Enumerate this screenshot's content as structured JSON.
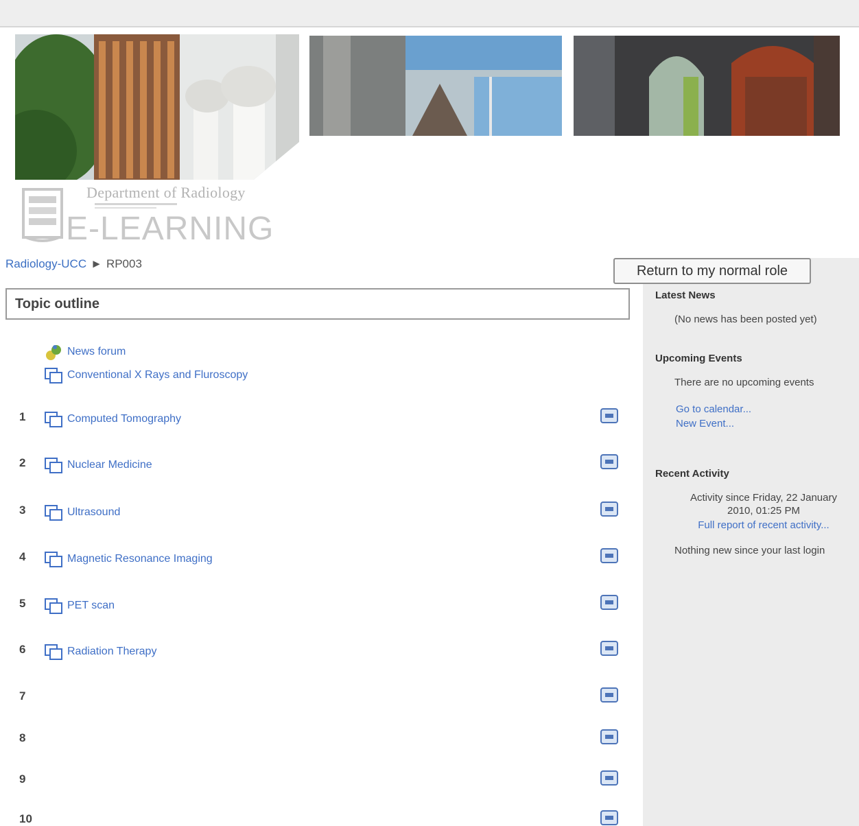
{
  "header": {
    "department": "Department of Radiology",
    "title": "E-LEARNING"
  },
  "breadcrumb": {
    "home": "Radiology-UCC",
    "separator": "►",
    "current": "RP003"
  },
  "role_button": "Return to my normal role",
  "topic_outline": {
    "title": "Topic outline",
    "general_activities": [
      {
        "icon": "forum-icon",
        "label": "News forum"
      },
      {
        "icon": "resource-icon",
        "label": "Conventional X Rays and Fluroscopy"
      }
    ],
    "sections": [
      {
        "number": "1",
        "activity": "Computed Tomography"
      },
      {
        "number": "2",
        "activity": "Nuclear Medicine"
      },
      {
        "number": "3",
        "activity": "Ultrasound"
      },
      {
        "number": "4",
        "activity": "Magnetic Resonance Imaging"
      },
      {
        "number": "5",
        "activity": "PET scan"
      },
      {
        "number": "6",
        "activity": "Radiation Therapy"
      },
      {
        "number": "7",
        "activity": ""
      },
      {
        "number": "8",
        "activity": ""
      },
      {
        "number": "9",
        "activity": ""
      },
      {
        "number": "10",
        "activity": ""
      }
    ]
  },
  "sidebar": {
    "latest_news": {
      "title": "Latest News",
      "text": "(No news has been posted yet)"
    },
    "upcoming_events": {
      "title": "Upcoming Events",
      "text": "There are no upcoming events",
      "links": [
        "Go to calendar...",
        "New Event..."
      ]
    },
    "recent_activity": {
      "title": "Recent Activity",
      "since_line1": "Activity since Friday, 22 January",
      "since_line2": "2010, 01:25 PM",
      "full_report": "Full report of recent activity...",
      "nothing_new": "Nothing new since your last login"
    }
  },
  "colors": {
    "link": "#3f6fc6",
    "sidebar_bg": "#ececec",
    "header_bar": "#eeeeee"
  }
}
